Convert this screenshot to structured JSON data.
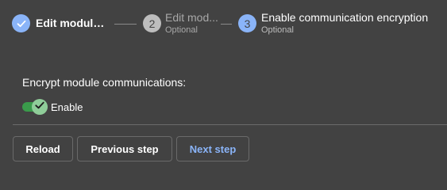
{
  "stepper": {
    "steps": [
      {
        "title": "Edit module c...",
        "optional": "",
        "status": "completed",
        "icon": "check-icon",
        "number": ""
      },
      {
        "title": "Edit mod...",
        "optional": "Optional",
        "status": "inactive",
        "icon": "step-number-icon",
        "number": "2"
      },
      {
        "title": "Enable communication encryption",
        "optional": "Optional",
        "status": "active",
        "icon": "step-number-icon",
        "number": "3"
      }
    ]
  },
  "content": {
    "label": "Encrypt module communications:",
    "toggle": {
      "label": "Enable",
      "checked": true,
      "icon": "check-icon"
    }
  },
  "actions": {
    "reload_label": "Reload",
    "previous_label": "Previous step",
    "next_label": "Next step"
  },
  "colors": {
    "background": "#424242",
    "step_completed": "#8ab4f8",
    "step_inactive": "#bdbdbd",
    "step_active": "#8ab4f8",
    "toggle_track": "#3a9b4b",
    "toggle_thumb": "#8fcd99",
    "next_button_text": "#8ab4f8"
  }
}
